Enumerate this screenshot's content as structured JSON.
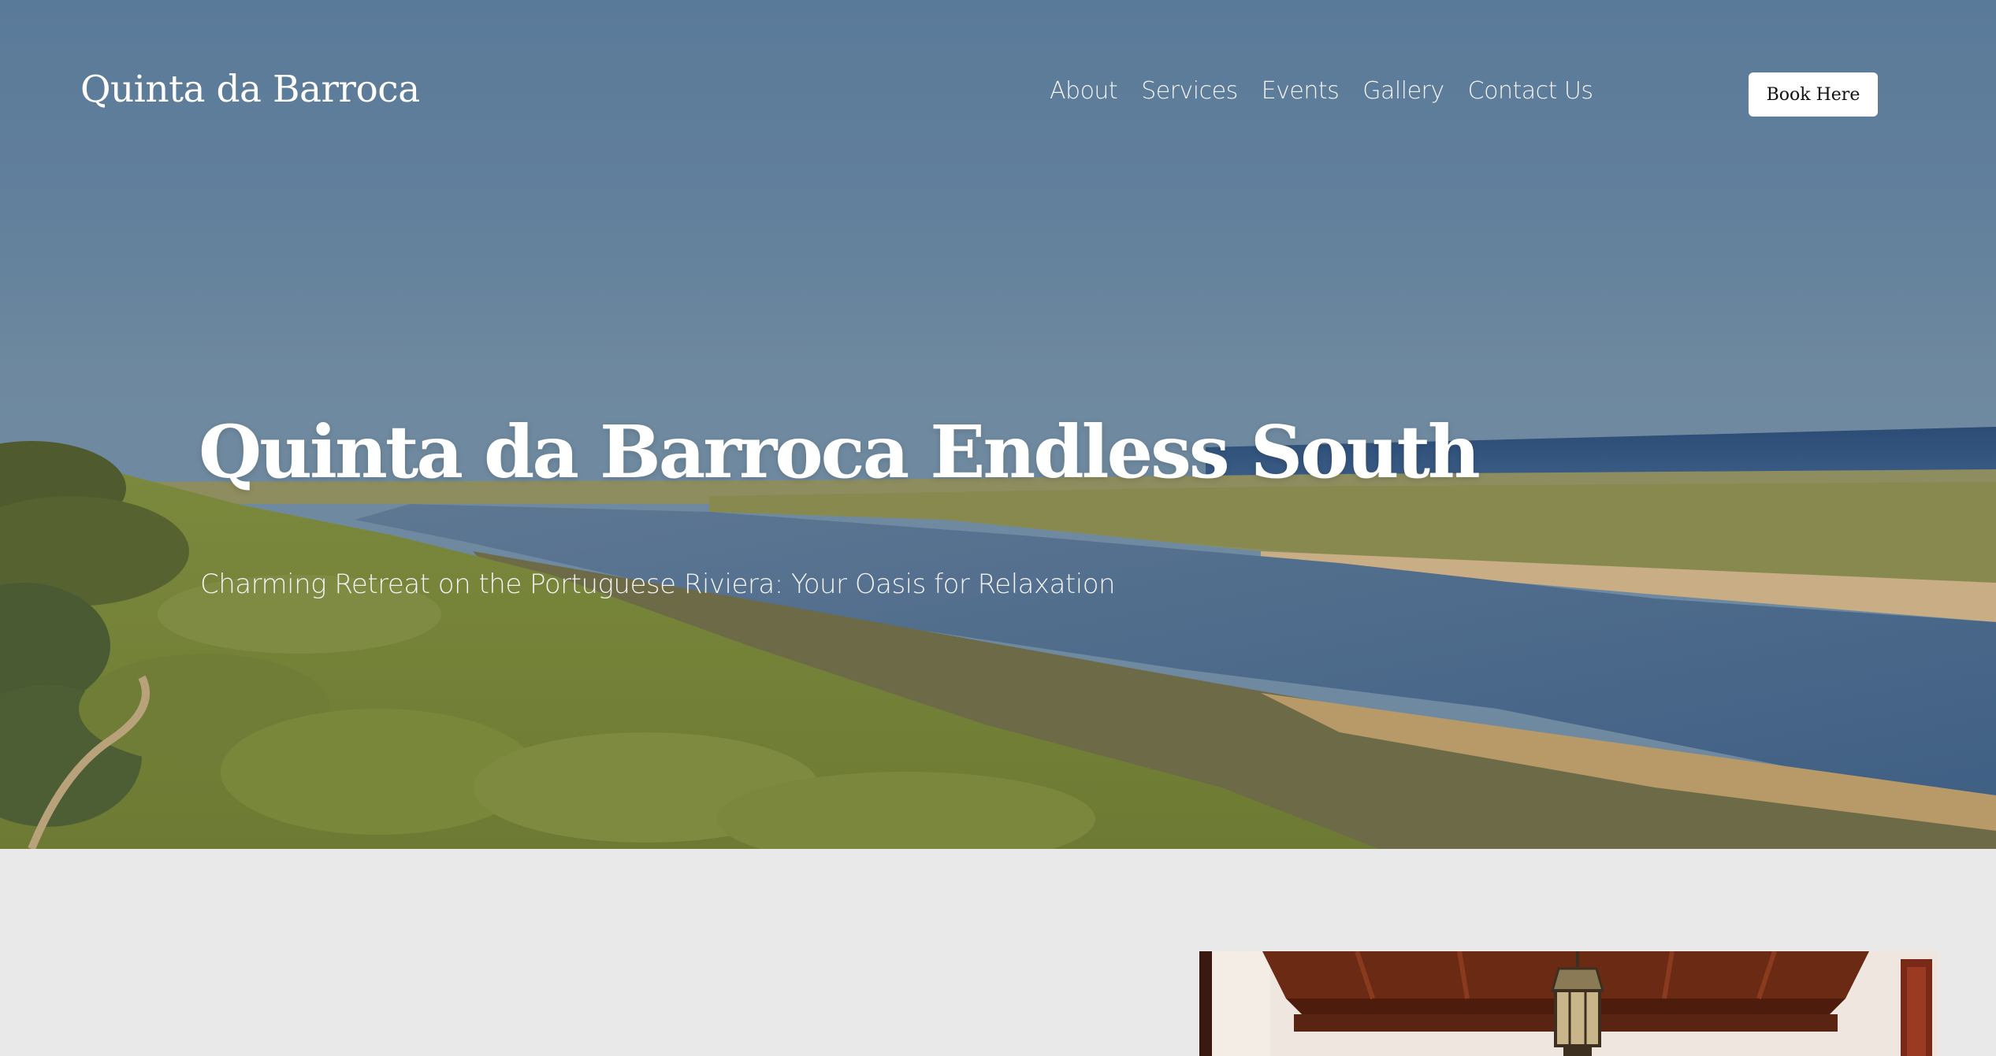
{
  "site": {
    "logo": "Quinta da Barroca"
  },
  "nav": {
    "items": [
      {
        "label": "About"
      },
      {
        "label": "Services"
      },
      {
        "label": "Events"
      },
      {
        "label": "Gallery"
      },
      {
        "label": "Contact Us"
      }
    ],
    "book_label": "Book Here"
  },
  "hero": {
    "title": "Quinta da Barroca Endless South",
    "subtitle": "Charming Retreat on the Portuguese Riviera: Your Oasis for Relaxation"
  },
  "colors": {
    "page_background": "#e9e9e9",
    "sky": "#62809c",
    "sea": "#2f4f78",
    "vegetation": "#7e8a45",
    "button_background": "#ffffff",
    "text_light": "#ffffff",
    "wood_ceiling": "#6b2a14"
  }
}
